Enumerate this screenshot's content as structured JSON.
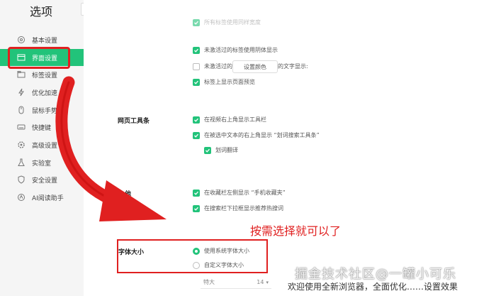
{
  "app": {
    "title": "选项"
  },
  "search": {
    "placeholder": ""
  },
  "sidebar": {
    "items": [
      {
        "label": "基本设置",
        "icon": "gear-icon"
      },
      {
        "label": "界面设置",
        "icon": "window-icon",
        "active": true
      },
      {
        "label": "标签设置",
        "icon": "tab-icon"
      },
      {
        "label": "优化加速",
        "icon": "lightning-icon"
      },
      {
        "label": "鼠标手势",
        "icon": "mouse-icon"
      },
      {
        "label": "快捷键",
        "icon": "keyboard-icon"
      },
      {
        "label": "高级设置",
        "icon": "advanced-gear-icon"
      },
      {
        "label": "实验室",
        "icon": "lab-flask-icon"
      },
      {
        "label": "安全设置",
        "icon": "shield-icon"
      },
      {
        "label": "AI阅读助手",
        "icon": "ai-reader-icon"
      }
    ]
  },
  "tabs_section": {
    "option_cut_top": "所有标签使用同样宽度",
    "options": [
      {
        "label": "未激活过的标签使用阴体显示",
        "checked": true
      },
      {
        "label": "未激活过的标签使用指定颜色的文字显示:",
        "checked": false
      },
      {
        "label": "标签上显示页面预览",
        "checked": true
      }
    ],
    "color_button": "设置颜色"
  },
  "toolbar_section": {
    "title": "网页工具条",
    "options": [
      {
        "label": "在视频右上角显示工具栏",
        "checked": true
      },
      {
        "label": "在被选中文本的右上角显示 “划词搜索工具条”",
        "checked": true
      },
      {
        "label": "划词翻译",
        "checked": true
      }
    ]
  },
  "other_section": {
    "title": "他",
    "options": [
      {
        "label": "在收藏栏左侧显示 “手机收藏夹”",
        "checked": true
      },
      {
        "label": "在搜索栏下拉框显示推荐热搜词",
        "checked": true
      }
    ]
  },
  "font_section": {
    "title": "字体大小",
    "options": [
      {
        "label": "使用系统字体大小",
        "selected": true
      },
      {
        "label": "自定义字体大小",
        "selected": false
      }
    ],
    "select_value": "特大",
    "select_size": "14"
  },
  "annotation": "按需选择就可以了",
  "watermark": "掘金技术社区@一罐小可乐",
  "bottom_overlay": "欢迎使用全新浏览器，全面优化……设置效果",
  "colors": {
    "accent": "#22c37a",
    "annotation_red": "#e02020",
    "sidebar_bg": "#f5f5f5"
  }
}
